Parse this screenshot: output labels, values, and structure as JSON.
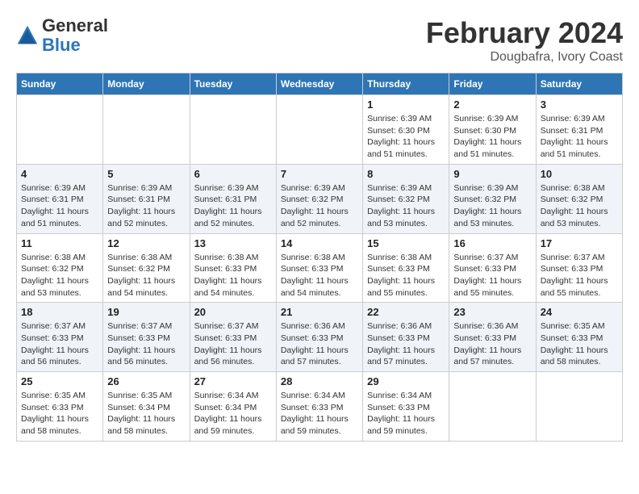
{
  "header": {
    "logo_general": "General",
    "logo_blue": "Blue",
    "month_year": "February 2024",
    "location": "Dougbafra, Ivory Coast"
  },
  "days_of_week": [
    "Sunday",
    "Monday",
    "Tuesday",
    "Wednesday",
    "Thursday",
    "Friday",
    "Saturday"
  ],
  "weeks": [
    [
      {
        "day": "",
        "info": ""
      },
      {
        "day": "",
        "info": ""
      },
      {
        "day": "",
        "info": ""
      },
      {
        "day": "",
        "info": ""
      },
      {
        "day": "1",
        "info": "Sunrise: 6:39 AM\nSunset: 6:30 PM\nDaylight: 11 hours\nand 51 minutes."
      },
      {
        "day": "2",
        "info": "Sunrise: 6:39 AM\nSunset: 6:30 PM\nDaylight: 11 hours\nand 51 minutes."
      },
      {
        "day": "3",
        "info": "Sunrise: 6:39 AM\nSunset: 6:31 PM\nDaylight: 11 hours\nand 51 minutes."
      }
    ],
    [
      {
        "day": "4",
        "info": "Sunrise: 6:39 AM\nSunset: 6:31 PM\nDaylight: 11 hours\nand 51 minutes."
      },
      {
        "day": "5",
        "info": "Sunrise: 6:39 AM\nSunset: 6:31 PM\nDaylight: 11 hours\nand 52 minutes."
      },
      {
        "day": "6",
        "info": "Sunrise: 6:39 AM\nSunset: 6:31 PM\nDaylight: 11 hours\nand 52 minutes."
      },
      {
        "day": "7",
        "info": "Sunrise: 6:39 AM\nSunset: 6:32 PM\nDaylight: 11 hours\nand 52 minutes."
      },
      {
        "day": "8",
        "info": "Sunrise: 6:39 AM\nSunset: 6:32 PM\nDaylight: 11 hours\nand 53 minutes."
      },
      {
        "day": "9",
        "info": "Sunrise: 6:39 AM\nSunset: 6:32 PM\nDaylight: 11 hours\nand 53 minutes."
      },
      {
        "day": "10",
        "info": "Sunrise: 6:38 AM\nSunset: 6:32 PM\nDaylight: 11 hours\nand 53 minutes."
      }
    ],
    [
      {
        "day": "11",
        "info": "Sunrise: 6:38 AM\nSunset: 6:32 PM\nDaylight: 11 hours\nand 53 minutes."
      },
      {
        "day": "12",
        "info": "Sunrise: 6:38 AM\nSunset: 6:32 PM\nDaylight: 11 hours\nand 54 minutes."
      },
      {
        "day": "13",
        "info": "Sunrise: 6:38 AM\nSunset: 6:33 PM\nDaylight: 11 hours\nand 54 minutes."
      },
      {
        "day": "14",
        "info": "Sunrise: 6:38 AM\nSunset: 6:33 PM\nDaylight: 11 hours\nand 54 minutes."
      },
      {
        "day": "15",
        "info": "Sunrise: 6:38 AM\nSunset: 6:33 PM\nDaylight: 11 hours\nand 55 minutes."
      },
      {
        "day": "16",
        "info": "Sunrise: 6:37 AM\nSunset: 6:33 PM\nDaylight: 11 hours\nand 55 minutes."
      },
      {
        "day": "17",
        "info": "Sunrise: 6:37 AM\nSunset: 6:33 PM\nDaylight: 11 hours\nand 55 minutes."
      }
    ],
    [
      {
        "day": "18",
        "info": "Sunrise: 6:37 AM\nSunset: 6:33 PM\nDaylight: 11 hours\nand 56 minutes."
      },
      {
        "day": "19",
        "info": "Sunrise: 6:37 AM\nSunset: 6:33 PM\nDaylight: 11 hours\nand 56 minutes."
      },
      {
        "day": "20",
        "info": "Sunrise: 6:37 AM\nSunset: 6:33 PM\nDaylight: 11 hours\nand 56 minutes."
      },
      {
        "day": "21",
        "info": "Sunrise: 6:36 AM\nSunset: 6:33 PM\nDaylight: 11 hours\nand 57 minutes."
      },
      {
        "day": "22",
        "info": "Sunrise: 6:36 AM\nSunset: 6:33 PM\nDaylight: 11 hours\nand 57 minutes."
      },
      {
        "day": "23",
        "info": "Sunrise: 6:36 AM\nSunset: 6:33 PM\nDaylight: 11 hours\nand 57 minutes."
      },
      {
        "day": "24",
        "info": "Sunrise: 6:35 AM\nSunset: 6:33 PM\nDaylight: 11 hours\nand 58 minutes."
      }
    ],
    [
      {
        "day": "25",
        "info": "Sunrise: 6:35 AM\nSunset: 6:33 PM\nDaylight: 11 hours\nand 58 minutes."
      },
      {
        "day": "26",
        "info": "Sunrise: 6:35 AM\nSunset: 6:34 PM\nDaylight: 11 hours\nand 58 minutes."
      },
      {
        "day": "27",
        "info": "Sunrise: 6:34 AM\nSunset: 6:34 PM\nDaylight: 11 hours\nand 59 minutes."
      },
      {
        "day": "28",
        "info": "Sunrise: 6:34 AM\nSunset: 6:33 PM\nDaylight: 11 hours\nand 59 minutes."
      },
      {
        "day": "29",
        "info": "Sunrise: 6:34 AM\nSunset: 6:33 PM\nDaylight: 11 hours\nand 59 minutes."
      },
      {
        "day": "",
        "info": ""
      },
      {
        "day": "",
        "info": ""
      }
    ]
  ]
}
